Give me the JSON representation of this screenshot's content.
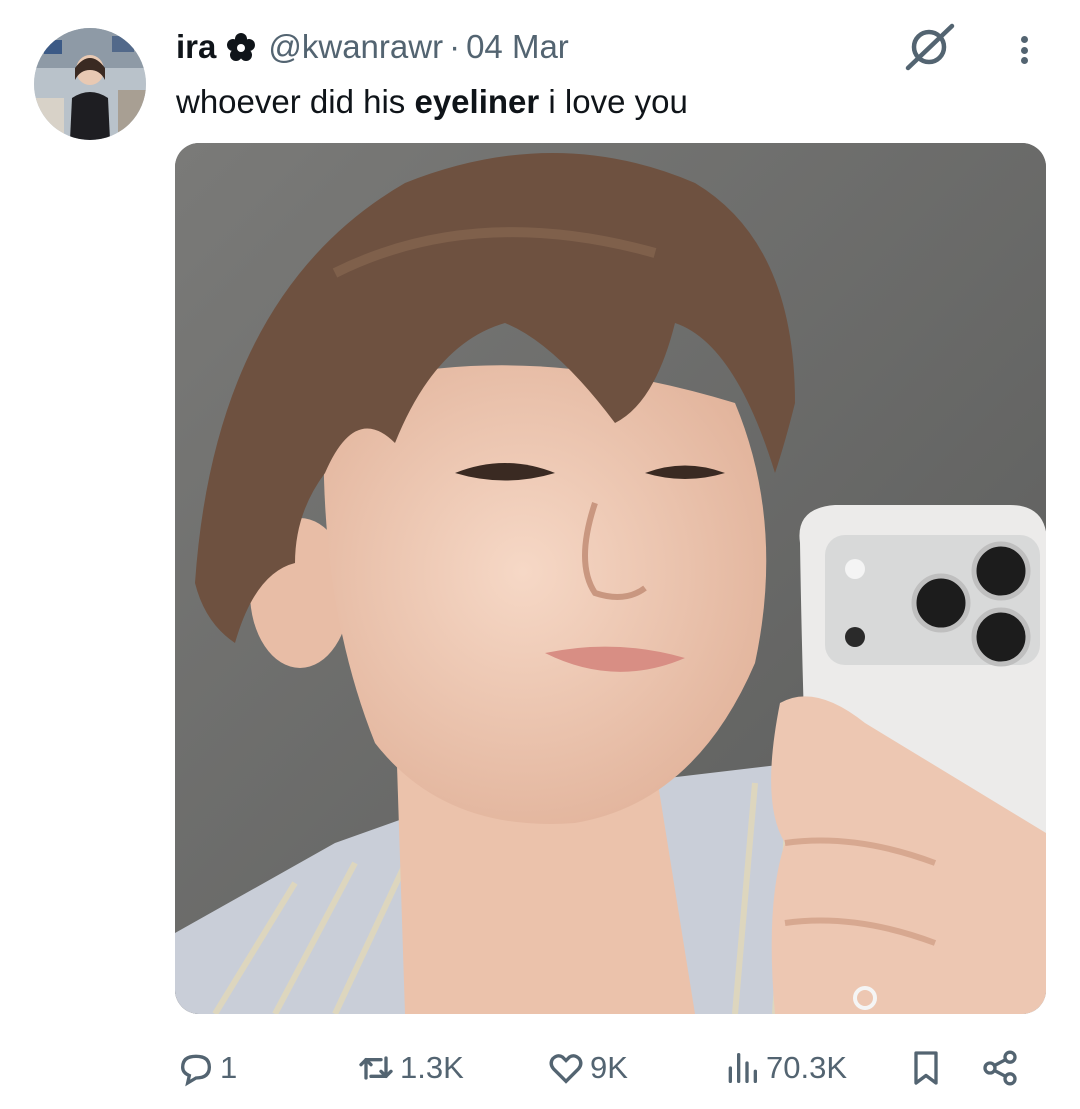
{
  "author": {
    "display_name": "ira",
    "badge_icon": "flower-icon",
    "handle": "@kwanrawr",
    "separator": "·",
    "date": "04 Mar"
  },
  "tweet": {
    "text_before": "whoever did his ",
    "text_bold": "eyeliner",
    "text_after": " i love you"
  },
  "header_icons": [
    "grok-icon",
    "more-icon"
  ],
  "actions": {
    "replies": "1",
    "reposts": "1.3K",
    "likes": "9K",
    "views": "70.3K"
  },
  "colors": {
    "text": "#0f1419",
    "secondary": "#536471",
    "background": "#ffffff"
  }
}
